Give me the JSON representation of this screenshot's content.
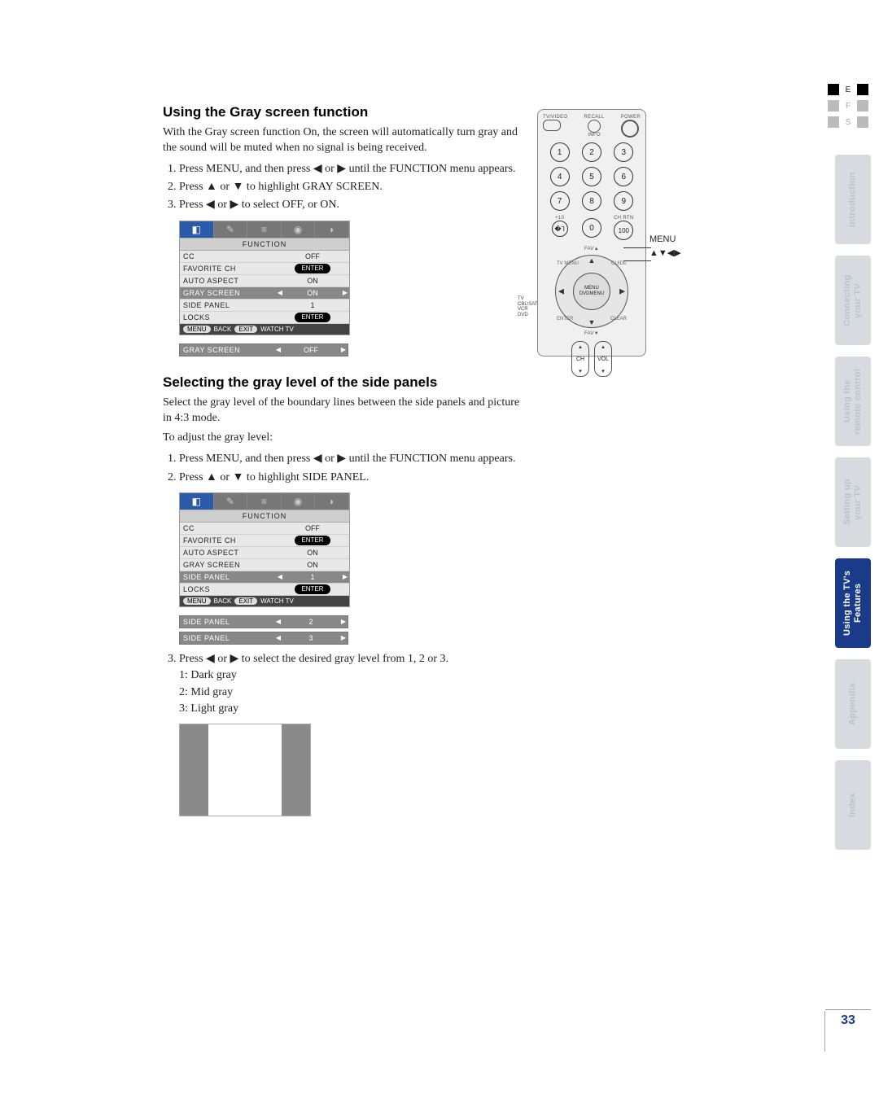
{
  "lang_tabs": {
    "e": "E",
    "f": "F",
    "s": "S"
  },
  "side_tabs": {
    "intro": "Introduction",
    "connecting": "Connecting\nyour TV",
    "remote": "Using the\nremote control",
    "setting": "Setting up\nyour TV",
    "features": "Using the TV's\nFeatures",
    "appendix": "Appendix",
    "index": "Index"
  },
  "page_number": "33",
  "remote": {
    "top": {
      "tvvideo": "TV/VIDEO",
      "recall": "RECALL",
      "info": "INFO",
      "power": "POWER"
    },
    "numbers": [
      "1",
      "2",
      "3",
      "4",
      "5",
      "6",
      "7",
      "8",
      "9",
      "+10",
      "0",
      "100"
    ],
    "chrtn": "CH RTN",
    "favup": "FAV▲",
    "favdn": "FAV▼",
    "menu": "MENU",
    "dvdmenu": "DVDMENU",
    "corner_tl": "TV MENU",
    "corner_tr": "GUIDE",
    "corner_bl": "ENTER",
    "corner_br": "CLEAR",
    "mode": "TV\nCBL/SAT\nVCR\nDVD",
    "ch": "CH",
    "vol": "VOL",
    "label_menu": "MENU",
    "label_arrows": "▲▼◀▶"
  },
  "section1": {
    "title": "Using the Gray screen function",
    "intro": "With the Gray screen function On, the screen will automatically turn gray and the sound will be muted when no signal is being received.",
    "steps": [
      "Press MENU, and then press ◀ or ▶ until the FUNCTION menu appears.",
      "Press ▲ or ▼ to highlight GRAY SCREEN.",
      "Press ◀ or ▶ to select OFF, or ON."
    ],
    "osd": {
      "head": "FUNCTION",
      "rows": [
        {
          "lab": "CC",
          "val": "OFF",
          "pill": false
        },
        {
          "lab": "FAVORITE CH",
          "val": "ENTER",
          "pill": true
        },
        {
          "lab": "AUTO ASPECT",
          "val": "ON",
          "pill": false
        },
        {
          "lab": "GRAY SCREEN",
          "val": "ON",
          "pill": false,
          "hl": true
        },
        {
          "lab": "SIDE PANEL",
          "val": "1",
          "pill": false
        },
        {
          "lab": "LOCKS",
          "val": "ENTER",
          "pill": true
        }
      ],
      "foot": {
        "menu": "MENU",
        "back": "BACK",
        "exit": "EXIT",
        "watch": "WATCH TV"
      }
    },
    "single": {
      "lab": "GRAY SCREEN",
      "val": "OFF"
    }
  },
  "section2": {
    "title": "Selecting the gray level of the side panels",
    "intro": "Select the gray level of the boundary lines between the side panels and picture in 4:3 mode.",
    "adjust": "To adjust the gray level:",
    "steps12": [
      "Press MENU, and then press ◀ or ▶ until the FUNCTION menu appears.",
      "Press ▲ or ▼ to highlight SIDE PANEL."
    ],
    "osd": {
      "head": "FUNCTION",
      "rows": [
        {
          "lab": "CC",
          "val": "OFF",
          "pill": false
        },
        {
          "lab": "FAVORITE CH",
          "val": "ENTER",
          "pill": true
        },
        {
          "lab": "AUTO ASPECT",
          "val": "ON",
          "pill": false
        },
        {
          "lab": "GRAY SCREEN",
          "val": "ON",
          "pill": false
        },
        {
          "lab": "SIDE PANEL",
          "val": "1",
          "pill": false,
          "hl": true
        },
        {
          "lab": "LOCKS",
          "val": "ENTER",
          "pill": true
        }
      ],
      "foot": {
        "menu": "MENU",
        "back": "BACK",
        "exit": "EXIT",
        "watch": "WATCH TV"
      }
    },
    "singles": [
      {
        "lab": "SIDE PANEL",
        "val": "2"
      },
      {
        "lab": "SIDE PANEL",
        "val": "3"
      }
    ],
    "step3": "Press ◀ or ▶ to select the desired gray level from 1, 2 or 3.",
    "levels": [
      "1: Dark gray",
      "2: Mid gray",
      "3: Light gray"
    ]
  }
}
